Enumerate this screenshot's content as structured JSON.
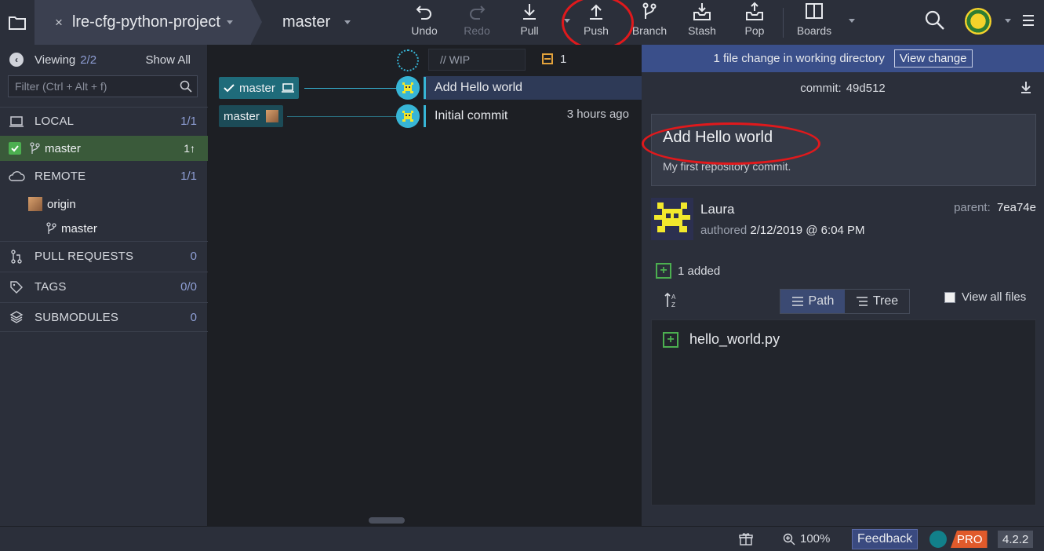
{
  "toolbar": {
    "repo_name": "lre-cfg-python-project",
    "repo_close": "×",
    "branch": "master",
    "buttons": {
      "undo": "Undo",
      "redo": "Redo",
      "pull": "Pull",
      "push": "Push",
      "branch": "Branch",
      "stash": "Stash",
      "pop": "Pop",
      "boards": "Boards"
    }
  },
  "sidebar": {
    "viewing_label": "Viewing",
    "viewing_count": "2/2",
    "show_all": "Show All",
    "filter_placeholder": "Filter (Ctrl + Alt + f)",
    "local": {
      "label": "LOCAL",
      "count": "1/1"
    },
    "local_branch": {
      "label": "master",
      "count": "1↑"
    },
    "remote": {
      "label": "REMOTE",
      "count": "1/1"
    },
    "remote_origin": "origin",
    "remote_branch": "master",
    "pull_requests": {
      "label": "PULL REQUESTS",
      "count": "0"
    },
    "tags": {
      "label": "TAGS",
      "count": "0/0"
    },
    "submodules": {
      "label": "SUBMODULES",
      "count": "0"
    }
  },
  "graph": {
    "wip_placeholder": "// WIP",
    "wip_count": "1",
    "commits": [
      {
        "branch_label": "master",
        "message": "Add Hello world",
        "time": ""
      },
      {
        "branch_label": "master",
        "message": "Initial commit",
        "time": "3 hours ago"
      }
    ]
  },
  "detail": {
    "banner_text": "1 file change in working directory",
    "view_change": "View change",
    "commit_label": "commit:",
    "commit_id": "49d512",
    "title": "Add Hello world",
    "body": "My first repository commit.",
    "author": "Laura",
    "authored_label": "authored",
    "authored_date": "2/12/2019 @ 6:04 PM",
    "parent_label": "parent:",
    "parent_id": "7ea74e",
    "added": "1 added",
    "path_label": "Path",
    "tree_label": "Tree",
    "view_all_files": "View all files",
    "files": [
      "hello_world.py"
    ]
  },
  "statusbar": {
    "zoom": "100%",
    "feedback": "Feedback",
    "pro": "PRO",
    "version": "4.2.2"
  },
  "colors": {
    "accent": "#37b5d6",
    "selected_row": "#2e3a57",
    "banner": "#3a4f8a",
    "added_green": "#4caf50",
    "annotation_red": "#e0191c"
  }
}
